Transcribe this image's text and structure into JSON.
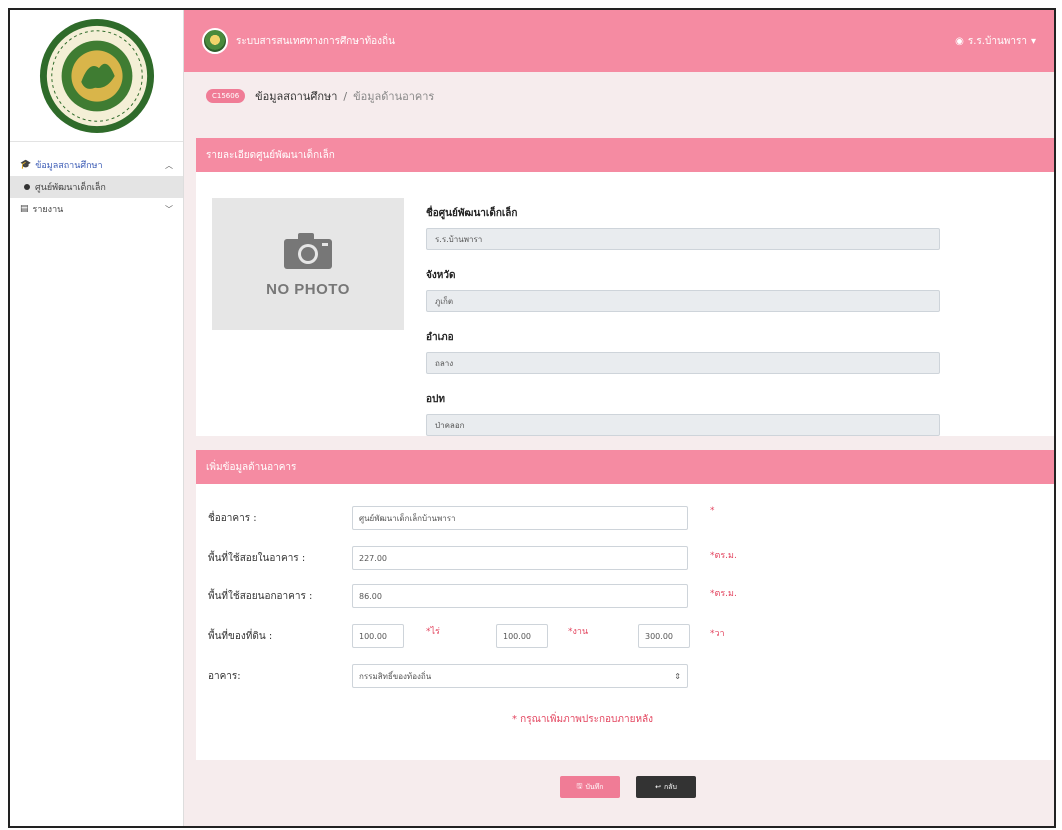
{
  "sidebar": {
    "items": [
      {
        "icon": "graduation-cap-icon",
        "label": "ข้อมูลสถานศึกษา",
        "expanded": true
      },
      {
        "icon": "dot-icon",
        "label": "ศูนย์พัฒนาเด็กเล็ก",
        "selected": true
      },
      {
        "icon": "report-icon",
        "label": "รายงาน",
        "expanded": false
      }
    ]
  },
  "topbar": {
    "title": "ระบบสารสนเทศทางการศึกษาท้องถิ่น",
    "user": "ร.ร.บ้านพารา"
  },
  "breadcrumb": {
    "badge": "C15606",
    "level1": "ข้อมูลสถานศึกษา",
    "separator": "/",
    "level2": "ข้อมูลด้านอาคาร"
  },
  "details_card": {
    "title": "รายละเอียดศูนย์พัฒนาเด็กเล็ก",
    "no_photo": "NO PHOTO",
    "fields": [
      {
        "label": "ชื่อศูนย์พัฒนาเด็กเล็ก",
        "value": "ร.ร.บ้านพารา"
      },
      {
        "label": "จังหวัด",
        "value": "ภูเก็ต"
      },
      {
        "label": "อำเภอ",
        "value": "ถลาง"
      },
      {
        "label": "อปท",
        "value": "ป่าคลอก"
      }
    ]
  },
  "building_form": {
    "title": "เพิ่มข้อมูลด้านอาคาร",
    "building_name": {
      "label": "ชื่ออาคาร :",
      "value": "ศูนย์พัฒนาเด็กเล็กบ้านพารา",
      "unit": "*"
    },
    "indoor_area": {
      "label": "พื้นที่ใช้สอยในอาคาร :",
      "value": "227.00",
      "unit": "*ตร.ม."
    },
    "outdoor_area": {
      "label": "พื้นที่ใช้สอยนอกอาคาร :",
      "value": "86.00",
      "unit": "*ตร.ม."
    },
    "land_area": {
      "label": "พื้นที่ของที่ดิน :",
      "rai": {
        "value": "100.00",
        "unit": "*ไร่"
      },
      "ngan": {
        "value": "100.00",
        "unit": "*งาน"
      },
      "wa": {
        "value": "300.00",
        "unit": "*วา"
      }
    },
    "building_type": {
      "label": "อาคาร:",
      "selected": "กรรมสิทธิ์ของท้องถิ่น"
    },
    "hint": "* กรุณาเพิ่มภาพประกอบภายหลัง"
  },
  "actions": {
    "save": "บันทึก",
    "back": "กลับ"
  },
  "colors": {
    "primary_pink": "#f58ba2",
    "accent_red": "#e3455f",
    "dark_button": "#333333"
  }
}
